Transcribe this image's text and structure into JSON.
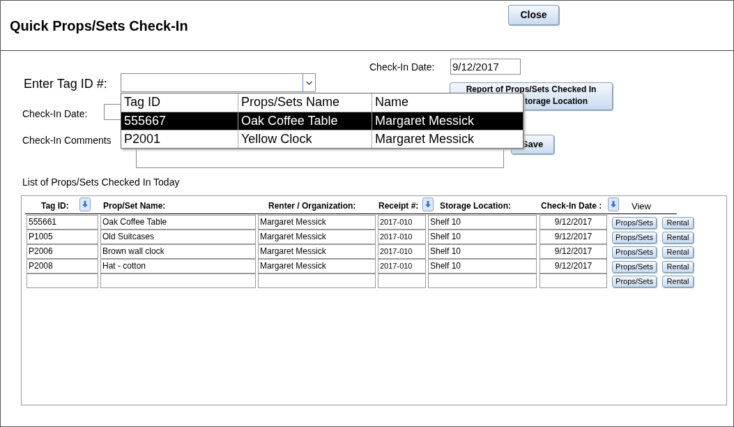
{
  "window": {
    "title": "Quick Props/Sets Check-In"
  },
  "close_button": "Close",
  "check_in_date_top": {
    "label": "Check-In Date:",
    "value": "9/12/2017"
  },
  "tag_id": {
    "label": "Enter Tag ID #:"
  },
  "report_button": {
    "line_1": "Report of Props/Sets Checked In",
    "line_2": "torage Location"
  },
  "check_in_date": {
    "label": "Check-In Date:"
  },
  "comments": {
    "label": "Check-In Comments"
  },
  "save_button": "Save",
  "dropdown": {
    "columns": [
      "Tag ID",
      "Props/Sets Name",
      "Name"
    ],
    "rows": [
      {
        "cells": [
          "555667",
          "Oak Coffee Table",
          "Margaret Messick"
        ],
        "selected": true
      },
      {
        "cells": [
          "P2001",
          "Yellow Clock",
          "Margaret Messick"
        ],
        "selected": false
      }
    ]
  },
  "list": {
    "title": "List of Props/Sets Checked In Today",
    "columns": [
      {
        "label": "Tag ID:",
        "sortable": true
      },
      {
        "label": "Prop/Set Name:",
        "sortable": false
      },
      {
        "label": "Renter / Organization:",
        "sortable": false
      },
      {
        "label": "Receipt #:",
        "sortable": true
      },
      {
        "label": "Storage Location:",
        "sortable": false
      },
      {
        "label": "Check-In Date :",
        "sortable": true
      },
      {
        "label": "View",
        "sortable": false
      }
    ],
    "rows": [
      {
        "kind": "record",
        "cells": [
          "555661",
          "Oak Coffee Table",
          "Margaret Messick",
          "2017-010",
          "Shelf 10",
          "9/12/2017"
        ],
        "buttons": [
          "Props/Sets",
          "Rental"
        ]
      },
      {
        "kind": "record",
        "cells": [
          "P1005",
          "Old Suitcases",
          "Margaret Messick",
          "2017-010",
          "Shelf 10",
          "9/12/2017"
        ],
        "buttons": [
          "Props/Sets",
          "Rental"
        ]
      },
      {
        "kind": "record",
        "cells": [
          "P2006",
          "Brown wall clock",
          "Margaret Messick",
          "2017-010",
          "Shelf 10",
          "9/12/2017"
        ],
        "buttons": [
          "Props/Sets",
          "Rental"
        ]
      },
      {
        "kind": "record",
        "cells": [
          "P2008",
          "Hat - cotton",
          "Margaret Messick",
          "2017-010",
          "Shelf 10",
          "9/12/2017"
        ],
        "buttons": [
          "Props/Sets",
          "Rental"
        ]
      },
      {
        "kind": "new",
        "buttons": [
          "Props/Sets",
          "Rental"
        ]
      }
    ]
  }
}
